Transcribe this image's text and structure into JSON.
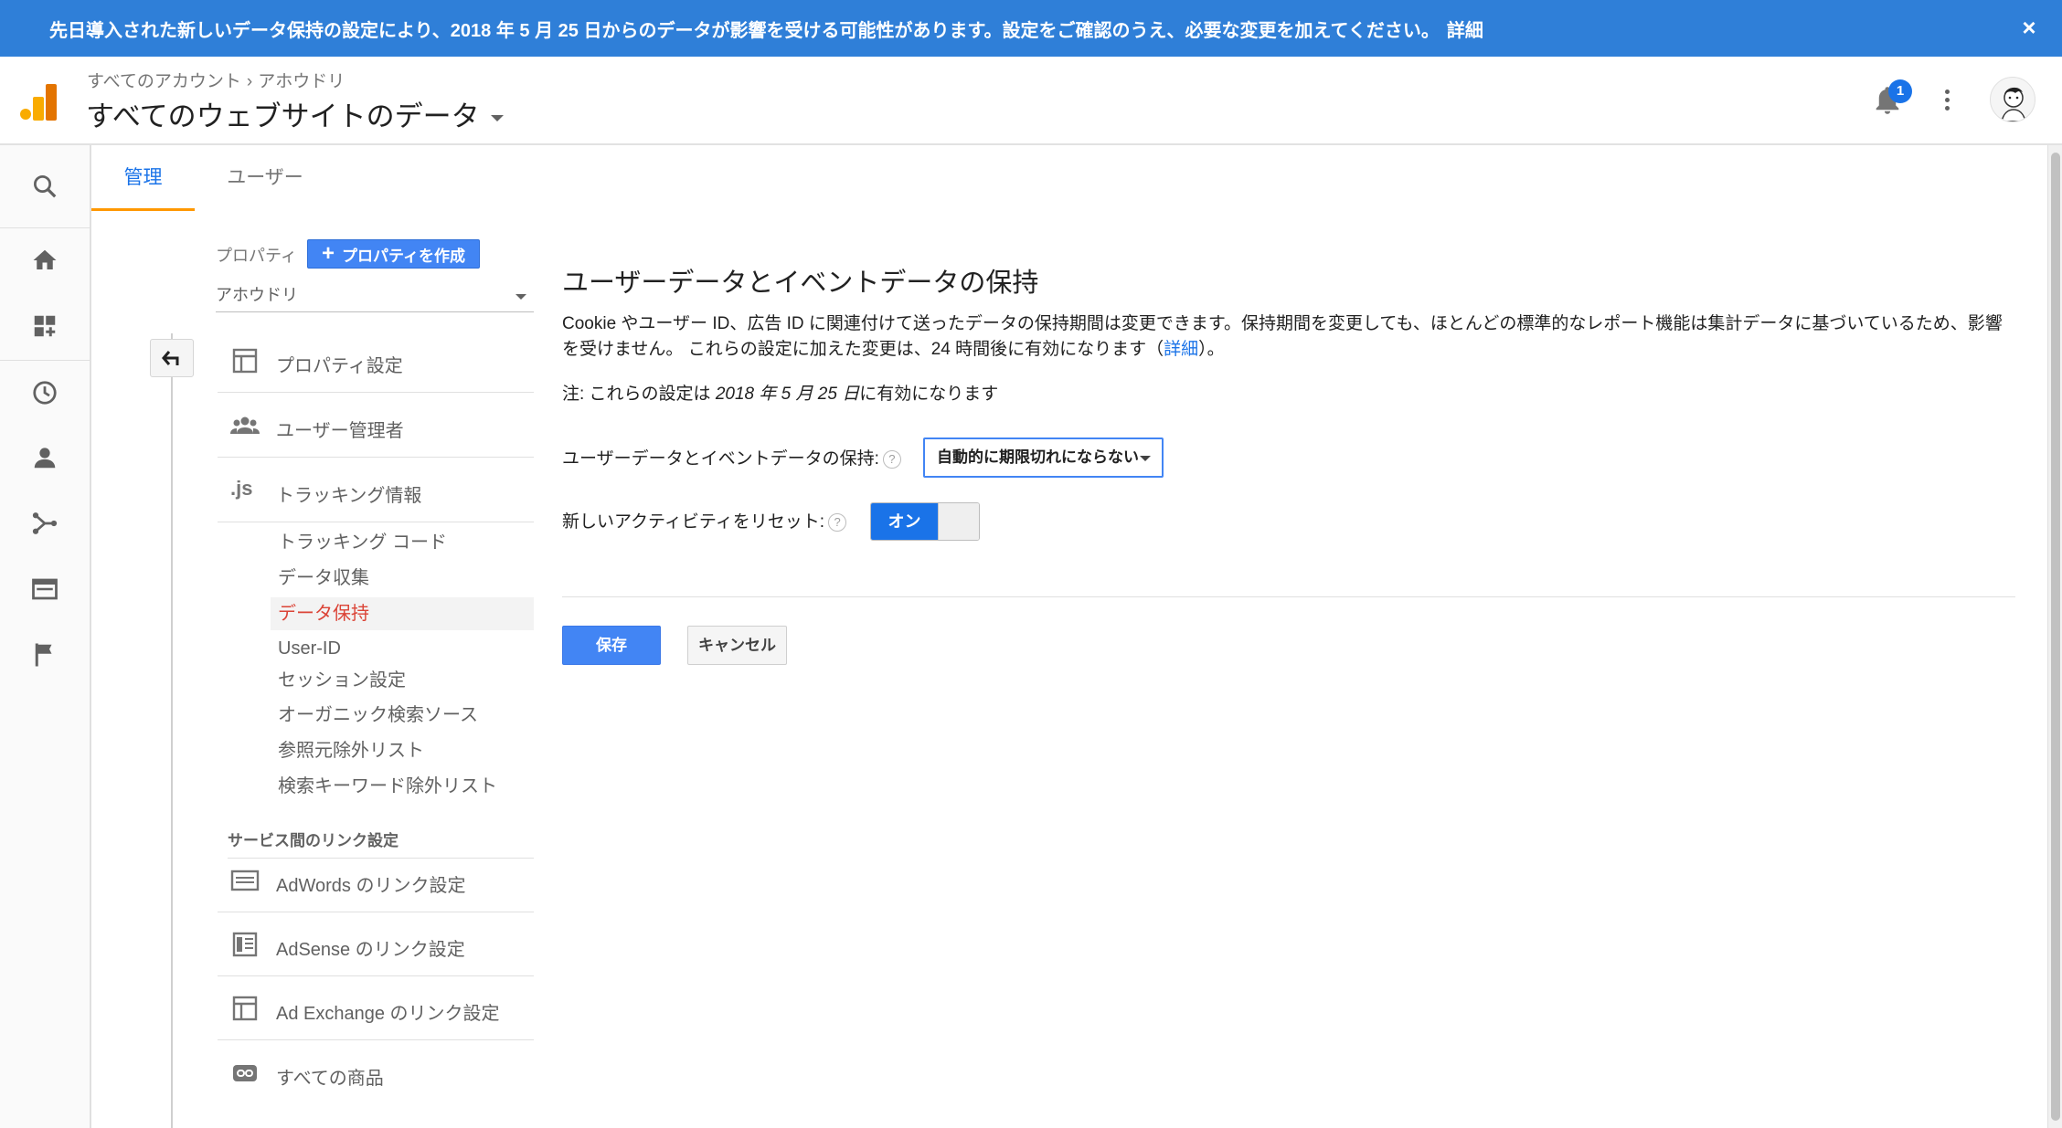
{
  "banner": {
    "message": "先日導入された新しいデータ保持の設定により、2018 年 5 月 25 日からのデータが影響を受ける可能性があります。設定をご確認のうえ、必要な変更を加えてください。",
    "link_label": "詳細",
    "close_glyph": "×",
    "color": "#2f7fd8"
  },
  "header": {
    "breadcrumb": [
      "すべてのアカウント",
      "アホウドリ"
    ],
    "breadcrumb_separator": "›",
    "account_title": "すべてのウェブサイトのデータ",
    "notification_count": "1",
    "icons": [
      "analytics-logo-icon",
      "bell-icon",
      "more-vert-icon",
      "avatar"
    ]
  },
  "rail": {
    "items": [
      "search-icon",
      "home-icon",
      "customization-icon",
      "realtime-icon",
      "audience-icon",
      "acquisition-icon",
      "behavior-icon",
      "conversions-icon"
    ]
  },
  "tabs": [
    {
      "label": "管理",
      "active": true
    },
    {
      "label": "ユーザー",
      "active": false
    }
  ],
  "property": {
    "label": "プロパティ",
    "create_button": "プロパティを作成",
    "create_plus": "+",
    "selected": "アホウドリ"
  },
  "nav": {
    "main": [
      {
        "label": "プロパティ設定",
        "icon": "property-settings-icon"
      },
      {
        "label": "ユーザー管理者",
        "icon": "users-icon"
      },
      {
        "label": "トラッキング情報",
        "icon": "js-icon",
        "icon_text": ".js"
      }
    ],
    "sub": [
      {
        "label": "トラッキング コード",
        "active": false
      },
      {
        "label": "データ収集",
        "active": false
      },
      {
        "label": "データ保持",
        "active": true
      },
      {
        "label": "User-ID",
        "active": false
      },
      {
        "label": "セッション設定",
        "active": false
      },
      {
        "label": "オーガニック検索ソース",
        "active": false
      },
      {
        "label": "参照元除外リスト",
        "active": false
      },
      {
        "label": "検索キーワード除外リスト",
        "active": false
      }
    ],
    "section_header": "サービス間のリンク設定",
    "links": [
      {
        "label": "AdWords のリンク設定",
        "icon": "adwords-icon"
      },
      {
        "label": "AdSense のリンク設定",
        "icon": "adsense-icon"
      },
      {
        "label": "Ad Exchange のリンク設定",
        "icon": "ad-exchange-icon"
      },
      {
        "label": "すべての商品",
        "icon": "link-icon"
      }
    ]
  },
  "main": {
    "title": "ユーザーデータとイベントデータの保持",
    "description_before": "Cookie やユーザー ID、広告 ID に関連付けて送ったデータの保持期間は変更できます。保持期間を変更しても、ほとんどの標準的なレポート機能は集計データに基づいているため、影響を受けません。 これらの設定に加えた変更は、24 時間後に有効になります（",
    "description_link": "詳細",
    "description_after": "）。",
    "note_prefix": "注: これらの設定は",
    "note_date": "2018 年 5 月 25 日",
    "note_suffix": "に有効になります",
    "retention_label": "ユーザーデータとイベントデータの保持:",
    "retention_value": "自動的に期限切れにならない",
    "reset_label": "新しいアクティビティをリセット:",
    "reset_state": "オン",
    "help_glyph": "?",
    "save_label": "保存",
    "cancel_label": "キャンセル",
    "accent": "#1a73e8",
    "active_nav_color": "#db4437"
  }
}
